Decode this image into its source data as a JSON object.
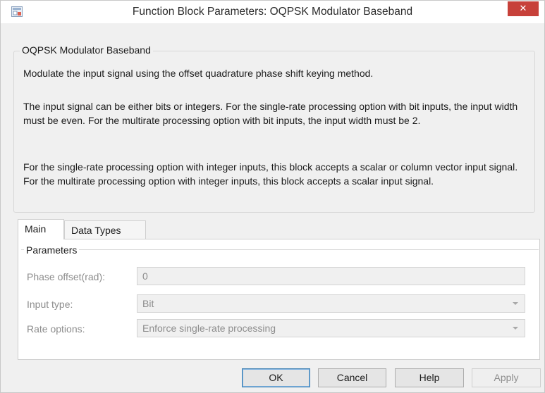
{
  "window": {
    "title": "Function Block Parameters: OQPSK Modulator Baseband",
    "close_glyph": "✕",
    "app_icon": "simulink-block-icon"
  },
  "description": {
    "legend": "OQPSK Modulator Baseband",
    "paragraphs": [
      "Modulate the input signal using the offset quadrature phase shift keying method.",
      "The input signal can be either bits or integers. For the single-rate processing option with bit inputs, the input width must be even. For the multirate processing option with bit inputs, the input width must be 2.",
      "For the single-rate processing option with integer inputs, this block accepts a scalar or column vector input signal. For the multirate processing option with integer inputs, this block accepts a scalar input signal."
    ]
  },
  "tabs": [
    {
      "label": "Main",
      "selected": true
    },
    {
      "label": "Data Types",
      "selected": false
    }
  ],
  "parameters": {
    "legend": "Parameters",
    "fields": [
      {
        "label": "Phase offset(rad):",
        "value": "0",
        "kind": "text",
        "enabled": false
      },
      {
        "label": "Input type:",
        "value": "Bit",
        "kind": "dropdown",
        "enabled": false
      },
      {
        "label": "Rate options:",
        "value": "Enforce single-rate processing",
        "kind": "dropdown",
        "enabled": false
      }
    ]
  },
  "buttons": {
    "ok": "OK",
    "cancel": "Cancel",
    "help": "Help",
    "apply": "Apply"
  }
}
